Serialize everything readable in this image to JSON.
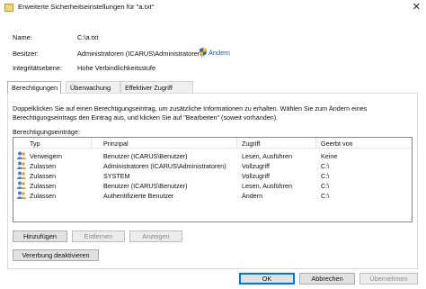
{
  "window": {
    "title": "Erweiterte Sicherheitseinstellungen für \"a.txt\"",
    "close_glyph": "✕"
  },
  "info": {
    "name_label": "Name:",
    "name_value": "C:\\a.txt",
    "owner_label": "Besitzer:",
    "owner_value": "Administratoren (ICARUS\\Administratoren)",
    "owner_change_link": "Ändern",
    "integrity_label": "Integritätsebene:",
    "integrity_value": "Hohe Verbindlichkeitsstufe"
  },
  "tabs": [
    {
      "label": "Berechtigungen",
      "active": true
    },
    {
      "label": "Überwachung",
      "active": false
    },
    {
      "label": "Effektiver Zugriff",
      "active": false
    }
  ],
  "permissions": {
    "description": "Doppelklicken Sie auf einen Berechtigungseintrag, um zusätzliche Informationen zu erhalten. Wählen Sie zum Ändern eines Berechtigungseintrags den Eintrag aus, und klicken Sie auf \"Bearbeiten\" (soweit vorhanden).",
    "list_label": "Berechtigungseinträge:",
    "columns": [
      "Typ",
      "Prinzipal",
      "Zugriff",
      "Geerbt von"
    ],
    "rows": [
      {
        "type": "Verweigern",
        "principal": "Benutzer (ICARUS\\Benutzer)",
        "access": "Lesen, Ausführen",
        "inherited": "Keine"
      },
      {
        "type": "Zulassen",
        "principal": "Administratoren (ICARUS\\Administratoren)",
        "access": "Vollzugriff",
        "inherited": "C:\\"
      },
      {
        "type": "Zulassen",
        "principal": "SYSTEM",
        "access": "Vollzugriff",
        "inherited": "C:\\"
      },
      {
        "type": "Zulassen",
        "principal": "Benutzer (ICARUS\\Benutzer)",
        "access": "Lesen, Ausführen",
        "inherited": "C:\\"
      },
      {
        "type": "Zulassen",
        "principal": "Authentifizierte Benutzer",
        "access": "Ändern",
        "inherited": "C:\\"
      }
    ],
    "buttons": {
      "add": "Hinzufügen",
      "remove": "Entfernen",
      "view": "Anzeigen",
      "disable_inheritance": "Vererbung deaktivieren"
    }
  },
  "footer": {
    "ok": "OK",
    "cancel": "Abbrechen",
    "apply": "Übernehmen"
  },
  "colors": {
    "accent": "#0078d7",
    "link": "#0b63c4"
  },
  "icons": {
    "app": "folder-lock-icon",
    "shield": "uac-shield-icon",
    "user": "users-icon"
  }
}
